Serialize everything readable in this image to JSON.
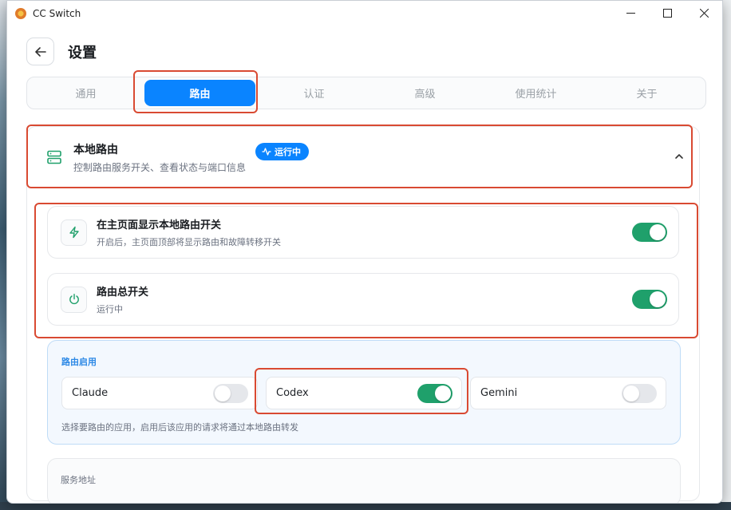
{
  "window": {
    "title": "CC Switch"
  },
  "header": {
    "title": "设置"
  },
  "tabs": [
    {
      "label": "通用",
      "active": false
    },
    {
      "label": "路由",
      "active": true
    },
    {
      "label": "认证",
      "active": false
    },
    {
      "label": "高级",
      "active": false
    },
    {
      "label": "使用统计",
      "active": false
    },
    {
      "label": "关于",
      "active": false
    }
  ],
  "section": {
    "title": "本地路由",
    "subtitle": "控制路由服务开关、查看状态与端口信息",
    "badge": "运行中",
    "expanded": true,
    "icon": "server-icon"
  },
  "rows": [
    {
      "title": "在主页面显示本地路由开关",
      "subtitle": "开启后，主页面顶部将显示路由和故障转移开关",
      "enabled": true,
      "icon": "lightning-icon"
    },
    {
      "title": "路由总开关",
      "subtitle": "运行中",
      "enabled": true,
      "icon": "power-icon"
    }
  ],
  "apps": {
    "label": "路由启用",
    "items": [
      {
        "name": "Claude",
        "enabled": false
      },
      {
        "name": "Codex",
        "enabled": true
      },
      {
        "name": "Gemini",
        "enabled": false
      }
    ],
    "hint": "选择要路由的应用，启用后该应用的请求将通过本地路由转发"
  },
  "service": {
    "label": "服务地址"
  },
  "colors": {
    "accent": "#0a84ff",
    "toggle_on": "#1fa06b",
    "highlight": "#d94a32"
  }
}
